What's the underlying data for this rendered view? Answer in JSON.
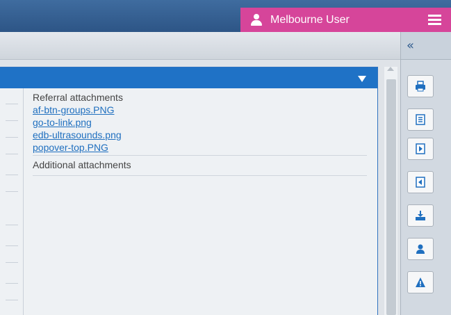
{
  "topbar": {
    "user_name": "Melbourne User",
    "colors": {
      "bar": "#2d5586",
      "user_pill": "#d6459a"
    },
    "icons": {
      "user": "user-icon",
      "menu": "hamburger-menu-icon"
    }
  },
  "sidebar_toggle": {
    "label": "«"
  },
  "attachments": {
    "referral_title": "Referral attachments",
    "referral_files": [
      "af-btn-groups.PNG",
      "go-to-link.png",
      "edb-ultrasounds.png",
      "popover-top.PNG"
    ],
    "additional_title": "Additional attachments"
  },
  "toolbar": {
    "buttons": [
      {
        "icon": "print-icon"
      },
      {
        "icon": "document-icon"
      },
      {
        "icon": "arrow-right-box-icon"
      },
      {
        "icon": "arrow-left-box-icon"
      },
      {
        "icon": "download-tray-icon"
      },
      {
        "icon": "person-icon"
      },
      {
        "icon": "warning-icon"
      }
    ]
  }
}
